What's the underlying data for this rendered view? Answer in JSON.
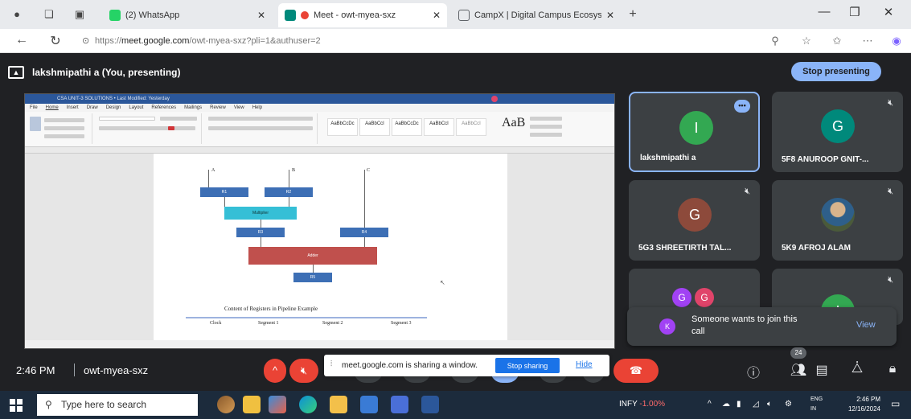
{
  "browser": {
    "tabs": [
      {
        "title": "(2) WhatsApp",
        "active": false,
        "favicon_color": "#25d366"
      },
      {
        "title": "Meet - owt-myea-sxz",
        "active": true,
        "favicon_color": "#00897b"
      },
      {
        "title": "CampX | Digital Campus Ecosyste",
        "active": false,
        "favicon_color": "#5f6368"
      }
    ],
    "new_tab": "+",
    "window_controls": {
      "minimize": "—",
      "maximize": "❐",
      "close": "✕"
    },
    "url_prefix": "https://",
    "url_host": "meet.google.com",
    "url_path": "/owt-myea-sxz?pli=1&authuser=2"
  },
  "meet": {
    "presenting_label": "lakshmipathi a (You, presenting)",
    "stop_presenting": "Stop presenting",
    "participants": [
      {
        "name": "lakshmipathi a",
        "initial": "I",
        "color": "#33a852",
        "active": true,
        "muted": false
      },
      {
        "name": "5F8 ANUROOP GNIT-...",
        "initial": "G",
        "color": "#00897b",
        "active": false,
        "muted": true
      },
      {
        "name": "5G3 SHREETIRTH TAL...",
        "initial": "G",
        "color": "#8d4a3b",
        "active": false,
        "muted": true
      },
      {
        "name": "5K9 AFROJ ALAM",
        "initial": "",
        "color": "#4a5a3a",
        "active": false,
        "muted": true
      },
      {
        "name": "",
        "initial": "G",
        "color": "#a142f4",
        "active": false,
        "muted": false
      },
      {
        "name": "",
        "initial": "I",
        "color": "#33a852",
        "active": false,
        "muted": true
      }
    ],
    "toast": {
      "avatar": "K",
      "message": "Someone wants to join this call",
      "action": "View"
    },
    "time": "2:46 PM",
    "meeting_code": "owt-myea-sxz",
    "share_bar": {
      "message": "meet.google.com is sharing a window.",
      "stop": "Stop sharing",
      "hide": "Hide"
    },
    "participant_count": "24"
  },
  "word": {
    "title": "CSA UNIT-3 SOLUTIONS • Last Modified: Yesterday",
    "menu": [
      "File",
      "Home",
      "Insert",
      "Draw",
      "Design",
      "Layout",
      "References",
      "Mailings",
      "Review",
      "View",
      "Help"
    ],
    "styles": [
      "AaBbCcDc",
      "AaBbCcI",
      "AaBbCcDc",
      "AaBbCcI",
      "AaBbCcI"
    ],
    "style_big": "AaB",
    "diagram": {
      "inputs": [
        "A",
        "B",
        "C"
      ],
      "regs": [
        "R1",
        "R2",
        "R3",
        "R4",
        "R5"
      ],
      "multiplier": "Multiplier",
      "adder": "Adder"
    },
    "caption": "Content of Registers in Pipeline Example",
    "table_headers": [
      "Clock",
      "Segment 1",
      "Segment 2",
      "Segment 3"
    ]
  },
  "taskbar": {
    "search_placeholder": "Type here to search",
    "stock_name": "INFY",
    "stock_change": "-1.00%",
    "language": "ENG",
    "region": "IN",
    "time": "2:46 PM",
    "date": "12/16/2024"
  }
}
